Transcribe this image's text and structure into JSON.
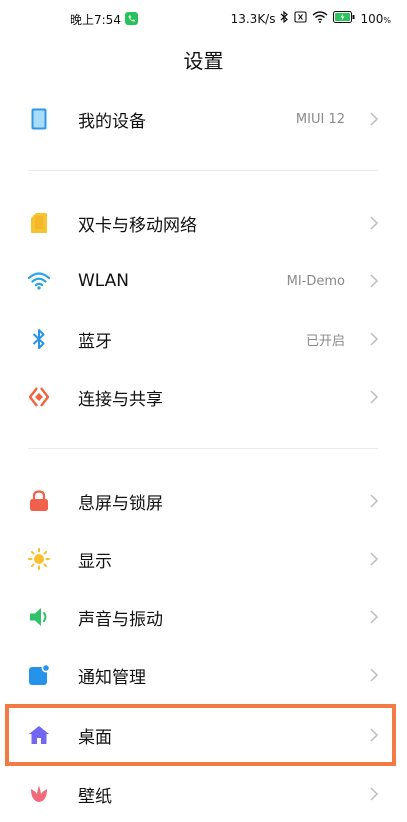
{
  "status": {
    "time": "晚上7:54",
    "speed": "13.3K/s",
    "battery": "100"
  },
  "title": "设置",
  "items": [
    {
      "label": "我的设备",
      "value": "MIUI 12"
    },
    {
      "label": "双卡与移动网络",
      "value": ""
    },
    {
      "label": "WLAN",
      "value": "MI-Demo"
    },
    {
      "label": "蓝牙",
      "value": "已开启"
    },
    {
      "label": "连接与共享",
      "value": ""
    },
    {
      "label": "息屏与锁屏",
      "value": ""
    },
    {
      "label": "显示",
      "value": ""
    },
    {
      "label": "声音与振动",
      "value": ""
    },
    {
      "label": "通知管理",
      "value": ""
    },
    {
      "label": "桌面",
      "value": ""
    },
    {
      "label": "壁纸",
      "value": ""
    }
  ],
  "colors": {
    "highlight": "#f27a45"
  }
}
